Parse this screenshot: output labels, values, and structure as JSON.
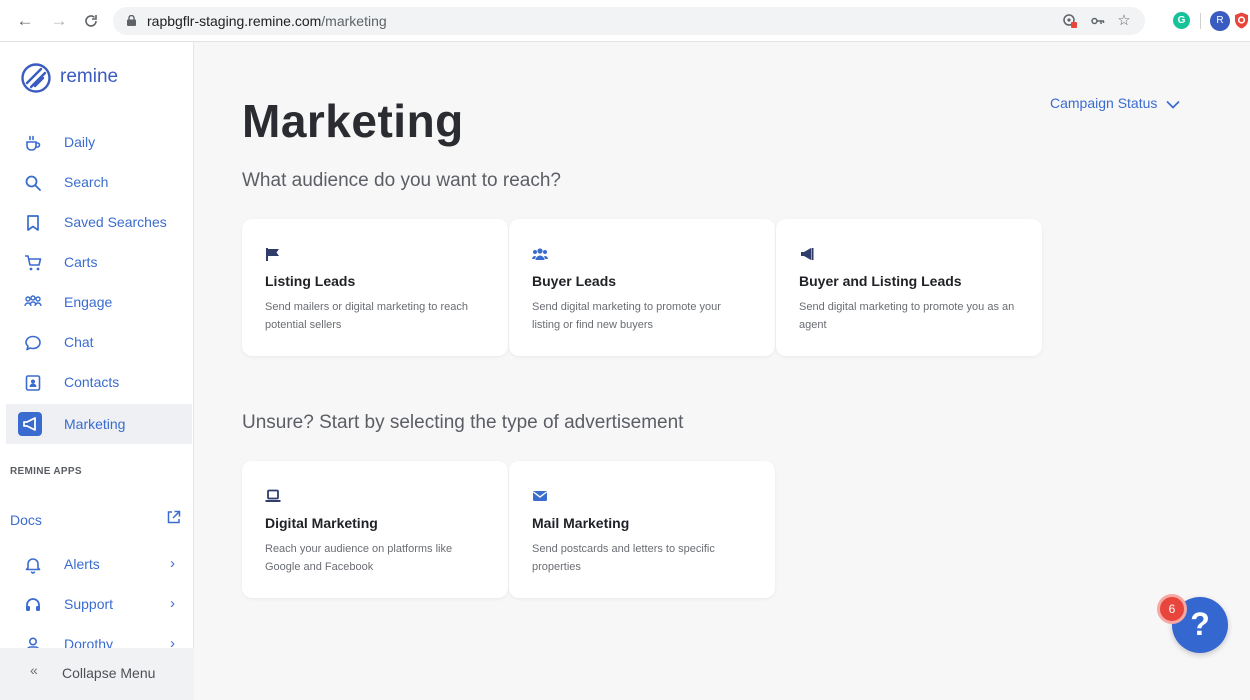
{
  "browser": {
    "url_host": "rapbgflr-staging.remine.com",
    "url_path": "/marketing",
    "profile_initial": "R",
    "grammarly_initial": "G"
  },
  "sidebar": {
    "brand": "remine",
    "items": [
      {
        "label": "Daily",
        "icon": "coffee-icon"
      },
      {
        "label": "Search",
        "icon": "search-icon"
      },
      {
        "label": "Saved Searches",
        "icon": "bookmark-icon"
      },
      {
        "label": "Carts",
        "icon": "cart-icon"
      },
      {
        "label": "Engage",
        "icon": "people-icon"
      },
      {
        "label": "Chat",
        "icon": "chat-bubble-icon"
      },
      {
        "label": "Contacts",
        "icon": "contact-card-icon"
      },
      {
        "label": "Marketing",
        "icon": "megaphone-icon",
        "active": true
      }
    ],
    "apps_section_title": "REMINE APPS",
    "docs_label": "Docs",
    "bottom_items": [
      {
        "label": "Alerts",
        "icon": "bell-icon"
      },
      {
        "label": "Support",
        "icon": "headset-icon"
      },
      {
        "label": "Dorothy",
        "icon": "user-icon"
      }
    ],
    "collapse_label": "Collapse Menu",
    "collapse_icon_glyph": "«"
  },
  "main": {
    "title": "Marketing",
    "campaign_status_label": "Campaign Status",
    "audience_question": "What audience do you want to reach?",
    "audience_cards": [
      {
        "title": "Listing Leads",
        "desc": "Send mailers or digital marketing to reach potential sellers",
        "icon": "flag-icon"
      },
      {
        "title": "Buyer Leads",
        "desc": "Send digital marketing to promote your listing or find new buyers",
        "icon": "users-icon"
      },
      {
        "title": "Buyer and Listing Leads",
        "desc": "Send digital marketing to promote you as an agent",
        "icon": "megaphone-icon"
      }
    ],
    "ad_type_question": "Unsure? Start by selecting the type of advertisement",
    "ad_type_cards": [
      {
        "title": "Digital Marketing",
        "desc": "Reach your audience on platforms like Google and Facebook",
        "icon": "laptop-icon"
      },
      {
        "title": "Mail Marketing",
        "desc": "Send postcards and letters to specific properties",
        "icon": "envelope-icon"
      }
    ]
  },
  "help": {
    "glyph": "?",
    "badge_count": "6"
  },
  "colors": {
    "accent": "#3a6ccf",
    "help_button": "#3567d0",
    "badge": "#e8453c"
  }
}
